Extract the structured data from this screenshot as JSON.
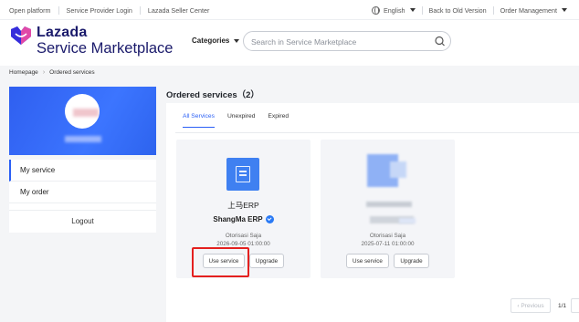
{
  "topbar": {
    "links": [
      "Open platform",
      "Service Provider Login",
      "Lazada Seller Center"
    ],
    "language": "English",
    "back_label": "Back to Old Version",
    "order_mgmt": "Order Management"
  },
  "header": {
    "brand_top": "Lazada",
    "brand_bottom": "Service Marketplace",
    "categories_label": "Categories",
    "search_placeholder": "Search in Service Marketplace"
  },
  "breadcrumb": [
    "Homepage",
    "Ordered services"
  ],
  "sidebar": {
    "menu": [
      "My service",
      "My order"
    ],
    "logout": "Logout"
  },
  "main": {
    "title": "Ordered services（2）",
    "tabs": [
      "All Services",
      "Unexpired",
      "Expired"
    ],
    "cards": [
      {
        "name_cn": "上马ERP",
        "name_en": "ShangMa ERP",
        "owner": "Otorisasi Saja",
        "expiry": "2026-09-05 01:00:00",
        "use_label": "Use service",
        "upgrade_label": "Upgrade"
      },
      {
        "name_cn": "",
        "name_en": "",
        "owner": "Otorisasi Saja",
        "expiry": "2025-07-11 01:00:00",
        "use_label": "Use service",
        "upgrade_label": "Upgrade"
      }
    ],
    "pager": {
      "prev_label": "‹ Previous",
      "page_text": "1/1"
    }
  },
  "colors": {
    "brand_blue": "#2a5ff5",
    "brand_navy": "#1a1a6b",
    "highlight_red": "#e4201f"
  }
}
